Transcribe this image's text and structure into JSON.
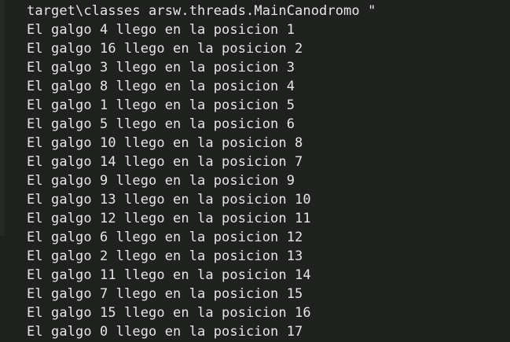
{
  "terminal": {
    "lines": [
      "target\\classes arsw.threads.MainCanodromo \"",
      "El galgo 4 llego en la posicion 1",
      "El galgo 16 llego en la posicion 2",
      "El galgo 3 llego en la posicion 3",
      "El galgo 8 llego en la posicion 4",
      "El galgo 1 llego en la posicion 5",
      "El galgo 5 llego en la posicion 6",
      "El galgo 10 llego en la posicion 8",
      "El galgo 14 llego en la posicion 7",
      "El galgo 9 llego en la posicion 9",
      "El galgo 13 llego en la posicion 10",
      "El galgo 12 llego en la posicion 11",
      "El galgo 6 llego en la posicion 12",
      "El galgo 2 llego en la posicion 13",
      "El galgo 11 llego en la posicion 14",
      "El galgo 7 llego en la posicion 15",
      "El galgo 15 llego en la posicion 16",
      "El galgo 0 llego en la posicion 17"
    ]
  }
}
